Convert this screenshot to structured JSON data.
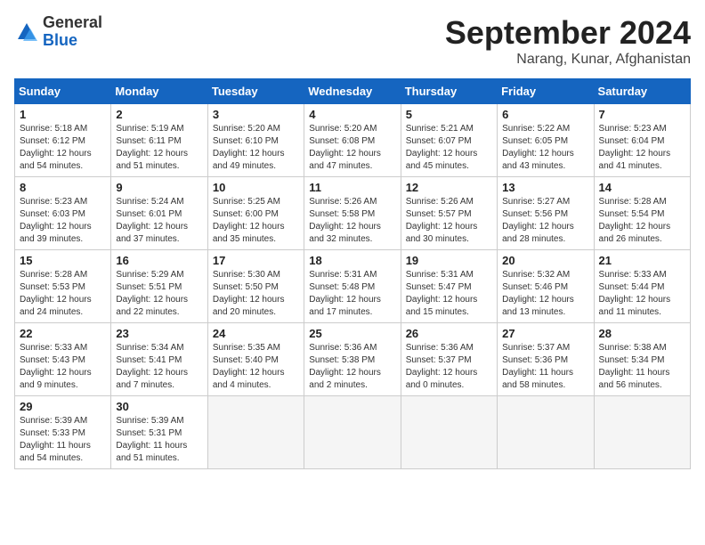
{
  "header": {
    "logo_general": "General",
    "logo_blue": "Blue",
    "month_year": "September 2024",
    "location": "Narang, Kunar, Afghanistan"
  },
  "weekdays": [
    "Sunday",
    "Monday",
    "Tuesday",
    "Wednesday",
    "Thursday",
    "Friday",
    "Saturday"
  ],
  "weeks": [
    [
      {
        "day": 1,
        "sunrise": "5:18 AM",
        "sunset": "6:12 PM",
        "daylight": "12 hours and 54 minutes."
      },
      {
        "day": 2,
        "sunrise": "5:19 AM",
        "sunset": "6:11 PM",
        "daylight": "12 hours and 51 minutes."
      },
      {
        "day": 3,
        "sunrise": "5:20 AM",
        "sunset": "6:10 PM",
        "daylight": "12 hours and 49 minutes."
      },
      {
        "day": 4,
        "sunrise": "5:20 AM",
        "sunset": "6:08 PM",
        "daylight": "12 hours and 47 minutes."
      },
      {
        "day": 5,
        "sunrise": "5:21 AM",
        "sunset": "6:07 PM",
        "daylight": "12 hours and 45 minutes."
      },
      {
        "day": 6,
        "sunrise": "5:22 AM",
        "sunset": "6:05 PM",
        "daylight": "12 hours and 43 minutes."
      },
      {
        "day": 7,
        "sunrise": "5:23 AM",
        "sunset": "6:04 PM",
        "daylight": "12 hours and 41 minutes."
      }
    ],
    [
      {
        "day": 8,
        "sunrise": "5:23 AM",
        "sunset": "6:03 PM",
        "daylight": "12 hours and 39 minutes."
      },
      {
        "day": 9,
        "sunrise": "5:24 AM",
        "sunset": "6:01 PM",
        "daylight": "12 hours and 37 minutes."
      },
      {
        "day": 10,
        "sunrise": "5:25 AM",
        "sunset": "6:00 PM",
        "daylight": "12 hours and 35 minutes."
      },
      {
        "day": 11,
        "sunrise": "5:26 AM",
        "sunset": "5:58 PM",
        "daylight": "12 hours and 32 minutes."
      },
      {
        "day": 12,
        "sunrise": "5:26 AM",
        "sunset": "5:57 PM",
        "daylight": "12 hours and 30 minutes."
      },
      {
        "day": 13,
        "sunrise": "5:27 AM",
        "sunset": "5:56 PM",
        "daylight": "12 hours and 28 minutes."
      },
      {
        "day": 14,
        "sunrise": "5:28 AM",
        "sunset": "5:54 PM",
        "daylight": "12 hours and 26 minutes."
      }
    ],
    [
      {
        "day": 15,
        "sunrise": "5:28 AM",
        "sunset": "5:53 PM",
        "daylight": "12 hours and 24 minutes."
      },
      {
        "day": 16,
        "sunrise": "5:29 AM",
        "sunset": "5:51 PM",
        "daylight": "12 hours and 22 minutes."
      },
      {
        "day": 17,
        "sunrise": "5:30 AM",
        "sunset": "5:50 PM",
        "daylight": "12 hours and 20 minutes."
      },
      {
        "day": 18,
        "sunrise": "5:31 AM",
        "sunset": "5:48 PM",
        "daylight": "12 hours and 17 minutes."
      },
      {
        "day": 19,
        "sunrise": "5:31 AM",
        "sunset": "5:47 PM",
        "daylight": "12 hours and 15 minutes."
      },
      {
        "day": 20,
        "sunrise": "5:32 AM",
        "sunset": "5:46 PM",
        "daylight": "12 hours and 13 minutes."
      },
      {
        "day": 21,
        "sunrise": "5:33 AM",
        "sunset": "5:44 PM",
        "daylight": "12 hours and 11 minutes."
      }
    ],
    [
      {
        "day": 22,
        "sunrise": "5:33 AM",
        "sunset": "5:43 PM",
        "daylight": "12 hours and 9 minutes."
      },
      {
        "day": 23,
        "sunrise": "5:34 AM",
        "sunset": "5:41 PM",
        "daylight": "12 hours and 7 minutes."
      },
      {
        "day": 24,
        "sunrise": "5:35 AM",
        "sunset": "5:40 PM",
        "daylight": "12 hours and 4 minutes."
      },
      {
        "day": 25,
        "sunrise": "5:36 AM",
        "sunset": "5:38 PM",
        "daylight": "12 hours and 2 minutes."
      },
      {
        "day": 26,
        "sunrise": "5:36 AM",
        "sunset": "5:37 PM",
        "daylight": "12 hours and 0 minutes."
      },
      {
        "day": 27,
        "sunrise": "5:37 AM",
        "sunset": "5:36 PM",
        "daylight": "11 hours and 58 minutes."
      },
      {
        "day": 28,
        "sunrise": "5:38 AM",
        "sunset": "5:34 PM",
        "daylight": "11 hours and 56 minutes."
      }
    ],
    [
      {
        "day": 29,
        "sunrise": "5:39 AM",
        "sunset": "5:33 PM",
        "daylight": "11 hours and 54 minutes."
      },
      {
        "day": 30,
        "sunrise": "5:39 AM",
        "sunset": "5:31 PM",
        "daylight": "11 hours and 51 minutes."
      },
      null,
      null,
      null,
      null,
      null
    ]
  ]
}
